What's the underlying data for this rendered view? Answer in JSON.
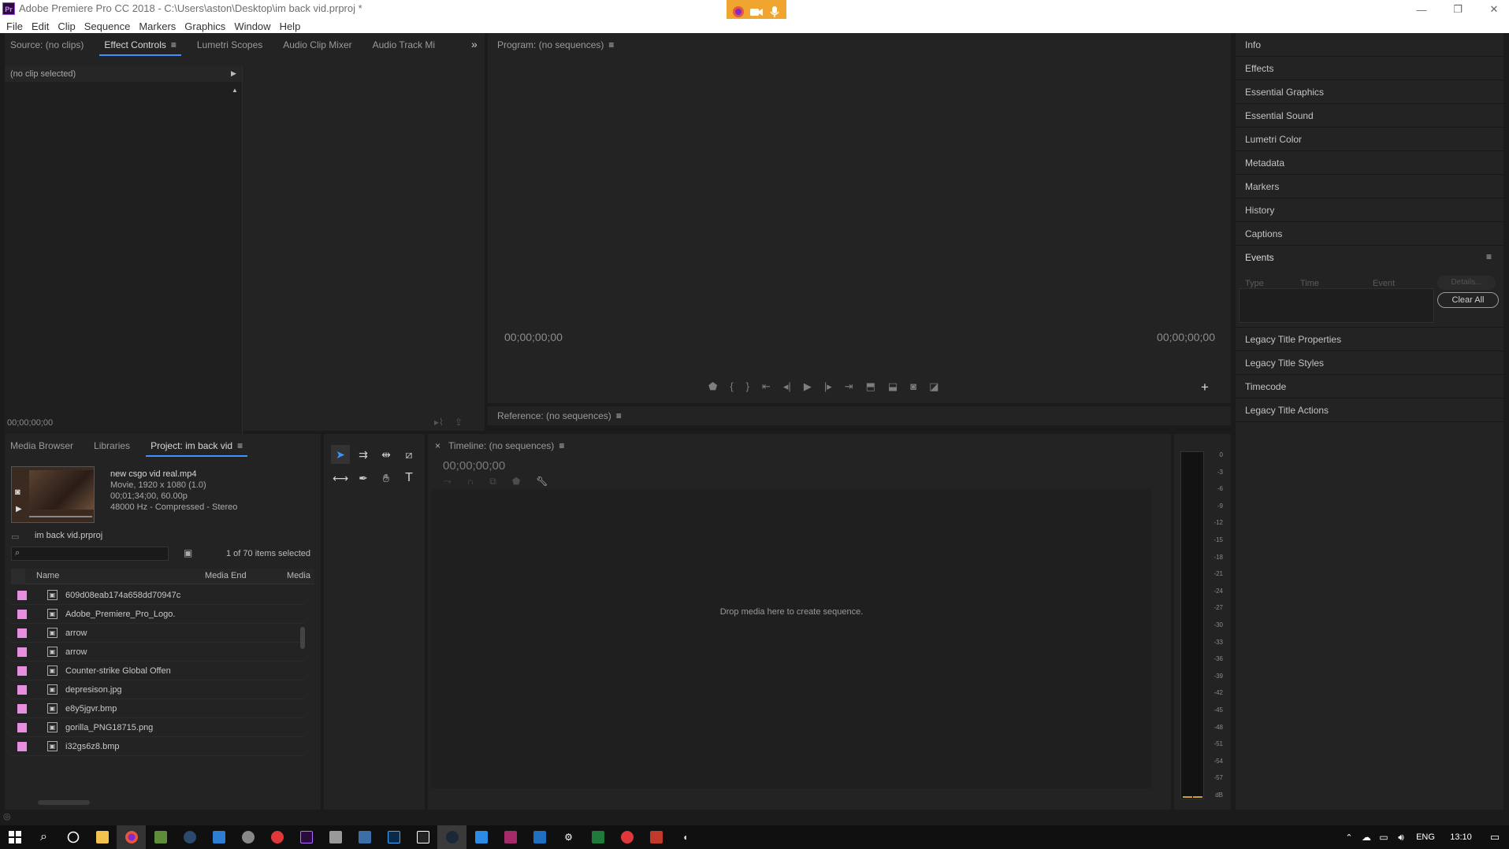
{
  "window": {
    "app_icon": "Pr",
    "title": "Adobe Premiere Pro CC 2018 - C:\\Users\\aston\\Desktop\\im back vid.prproj *",
    "recorder_icons": [
      "firefox-icon",
      "camera-icon",
      "microphone-icon"
    ]
  },
  "menu": [
    "File",
    "Edit",
    "Clip",
    "Sequence",
    "Markers",
    "Graphics",
    "Window",
    "Help"
  ],
  "source_panel": {
    "tabs": [
      "Source: (no clips)",
      "Effect Controls",
      "Lumetri Scopes",
      "Audio Clip Mixer",
      "Audio Track Mi"
    ],
    "active_tab": "Effect Controls",
    "no_clip": "(no clip selected)",
    "timecode": "00;00;00;00"
  },
  "program_monitor": {
    "title": "Program: (no sequences)",
    "timecode_left": "00;00;00;00",
    "timecode_right": "00;00;00;00"
  },
  "reference_monitor": {
    "title": "Reference: (no sequences)"
  },
  "right_panel": {
    "items_top": [
      "Info",
      "Effects",
      "Essential Graphics",
      "Essential Sound",
      "Lumetri Color",
      "Metadata",
      "Markers",
      "History",
      "Captions"
    ],
    "events": {
      "title": "Events",
      "columns": [
        "Type",
        "Time",
        "Event"
      ],
      "details_label": "Details...",
      "clear_label": "Clear All"
    },
    "items_bottom": [
      "Legacy Title Properties",
      "Legacy Title Styles",
      "Timecode",
      "Legacy Title Actions"
    ]
  },
  "project_panel": {
    "tabs": [
      "Media Browser",
      "Libraries",
      "Project: im back vid"
    ],
    "active_tab": "Project: im back vid",
    "preview": {
      "name": "new csgo vid real.mp4",
      "line1": "Movie, 1920 x 1080 (1.0)",
      "line2": "00;01;34;00, 60.00p",
      "line3": "48000 Hz - Compressed - Stereo"
    },
    "project_file": "im back vid.prproj",
    "search_value": "",
    "selection_count": "1 of 70 items selected",
    "columns": [
      "Name",
      "Media End",
      "Media"
    ],
    "swatch_color": "#e98de0",
    "items": [
      "609d08eab174a658dd70947c",
      "Adobe_Premiere_Pro_Logo.",
      "arrow",
      "arrow",
      "Counter-strike  Global Offen",
      "depresison.jpg",
      "e8y5jgvr.bmp",
      "gorilla_PNG18715.png",
      "i32gs6z8.bmp"
    ]
  },
  "timeline": {
    "title": "Timeline: (no sequences)",
    "timecode": "00;00;00;00",
    "drop_hint": "Drop media here to create sequence."
  },
  "audio_meter": {
    "ticks": [
      "0",
      "-3",
      "-6",
      "-9",
      "-12",
      "-15",
      "-18",
      "-21",
      "-24",
      "-27",
      "-30",
      "-33",
      "-36",
      "-39",
      "-42",
      "-45",
      "-48",
      "-51",
      "-54",
      "-57",
      "dB"
    ]
  },
  "taskbar": {
    "language": "ENG",
    "time": "13:10"
  }
}
